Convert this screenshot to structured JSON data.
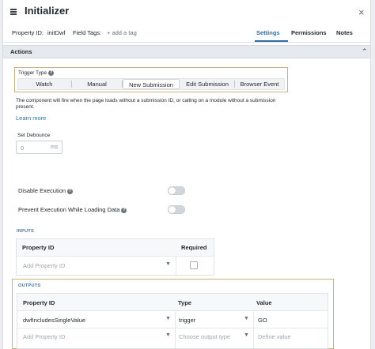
{
  "header": {
    "title": "Initializer",
    "property_id_label": "Property ID:",
    "property_id_value": "initDwf",
    "field_tags_label": "Field Tags:",
    "add_tag": "+ add a tag",
    "close_glyph": "×",
    "tabs": [
      {
        "label": "Settings",
        "active": true
      },
      {
        "label": "Permissions",
        "active": false
      },
      {
        "label": "Notes",
        "active": false
      }
    ]
  },
  "actions": {
    "section_title": "Actions",
    "trigger_type_label": "Trigger Type",
    "trigger_options": [
      "Watch",
      "Manual",
      "New Submission",
      "Edit Submission",
      "Browser Event"
    ],
    "selected_trigger": "New Submission",
    "description": "The component will fire when the page loads without a submission ID, or calling on a module without a submission present.",
    "learn_more": "Learn more",
    "debounce_label": "Set Debounce",
    "debounce_placeholder": "0",
    "debounce_unit": "ms",
    "disable_execution_label": "Disable Execution",
    "disable_execution_on": false,
    "prevent_execution_label": "Prevent Execution While Loading Data",
    "prevent_execution_on": false
  },
  "inputs": {
    "group_label": "INPUTS",
    "columns": [
      "Property ID",
      "Required"
    ],
    "row_placeholder": "Add Property ID",
    "required_checked": false
  },
  "outputs": {
    "group_label": "OUTPUTS",
    "columns": [
      "Property ID",
      "Type",
      "Value"
    ],
    "rows": [
      {
        "property_id": "dwfIncludesSingleValue",
        "type": "trigger",
        "value": "GO"
      }
    ],
    "new_row": {
      "property_id_placeholder": "Add Property ID",
      "type_placeholder": "Choose output type",
      "value_placeholder": "Define value"
    }
  },
  "colors": {
    "accent": "#2f6fa6",
    "highlight_border": "#c9b37a",
    "group_label": "#4b74a0"
  }
}
